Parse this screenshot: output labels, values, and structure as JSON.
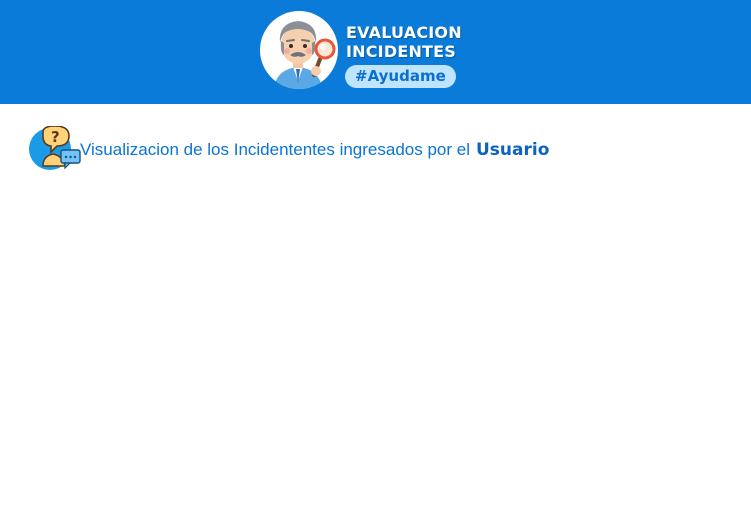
{
  "header": {
    "brand_line_1": "EVALUACION",
    "brand_line_2": "INCIDENTES",
    "hashtag": "#Ayudame",
    "avatar_icon": "inspector-magnifier-icon",
    "background_color": "#0a7bd9"
  },
  "main": {
    "heading_text": "Visualizacion de los Incidententes ingresados por el",
    "heading_emphasis": "Usuario",
    "heading_icon": "question-chat-icon"
  }
}
